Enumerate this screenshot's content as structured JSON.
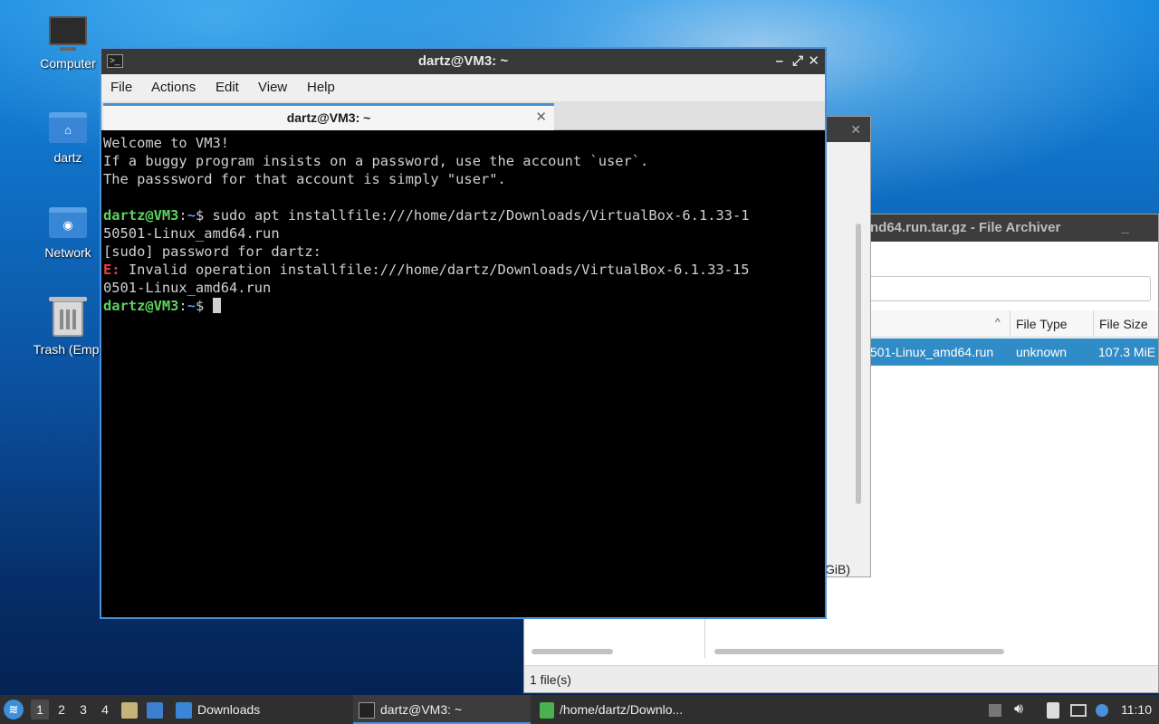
{
  "desktop": {
    "icons": [
      {
        "label": "Computer",
        "icon": "computer-icon"
      },
      {
        "label": "dartz",
        "icon": "home-folder-icon"
      },
      {
        "label": "Network",
        "icon": "network-folder-icon"
      },
      {
        "label": "Trash (Empt",
        "icon": "trash-icon"
      }
    ]
  },
  "archiver": {
    "title": "nd64.run.tar.gz - File Archiver",
    "columns": {
      "type": "File Type",
      "size": "File Size"
    },
    "row": {
      "name": "501-Linux_amd64.run",
      "type": "unknown",
      "size": "107.3 MiE"
    },
    "status": "1 file(s)",
    "sort_arrow": "^"
  },
  "middle_window": {
    "partial_text": "GiB)"
  },
  "terminal": {
    "title": "dartz@VM3: ~",
    "menu": [
      "File",
      "Actions",
      "Edit",
      "View",
      "Help"
    ],
    "tab_title": "dartz@VM3: ~",
    "tab_close": "✕",
    "controls": {
      "minimize": "–",
      "maximize": "⤢",
      "close": "✕"
    },
    "lines": {
      "l1": "Welcome to VM3!",
      "l2": "If a buggy program insists on a password, use the account `user`.",
      "l3": "The passsword for that account is simply \"user\".",
      "prompt_user": "dartz@VM3",
      "prompt_sep": ":",
      "prompt_path": "~",
      "prompt_dollar": "$",
      "cmd": " sudo apt installfile:///home/dartz/Downloads/VirtualBox-6.1.33-1",
      "cmd_cont": "50501-Linux_amd64.run",
      "sudo": "[sudo] password for dartz:",
      "err_tag": "E:",
      "err_msg": " Invalid operation installfile:///home/dartz/Downloads/VirtualBox-6.1.33-15",
      "err_cont": "0501-Linux_amd64.run"
    }
  },
  "taskbar": {
    "workspaces": [
      "1",
      "2",
      "3",
      "4"
    ],
    "tasks": [
      {
        "label": "Downloads",
        "icon": "folder-icon"
      },
      {
        "label": "dartz@VM3: ~",
        "icon": "terminal-icon"
      },
      {
        "label": "/home/dartz/Downlo...",
        "icon": "archive-icon"
      }
    ],
    "clock": "11:10"
  }
}
